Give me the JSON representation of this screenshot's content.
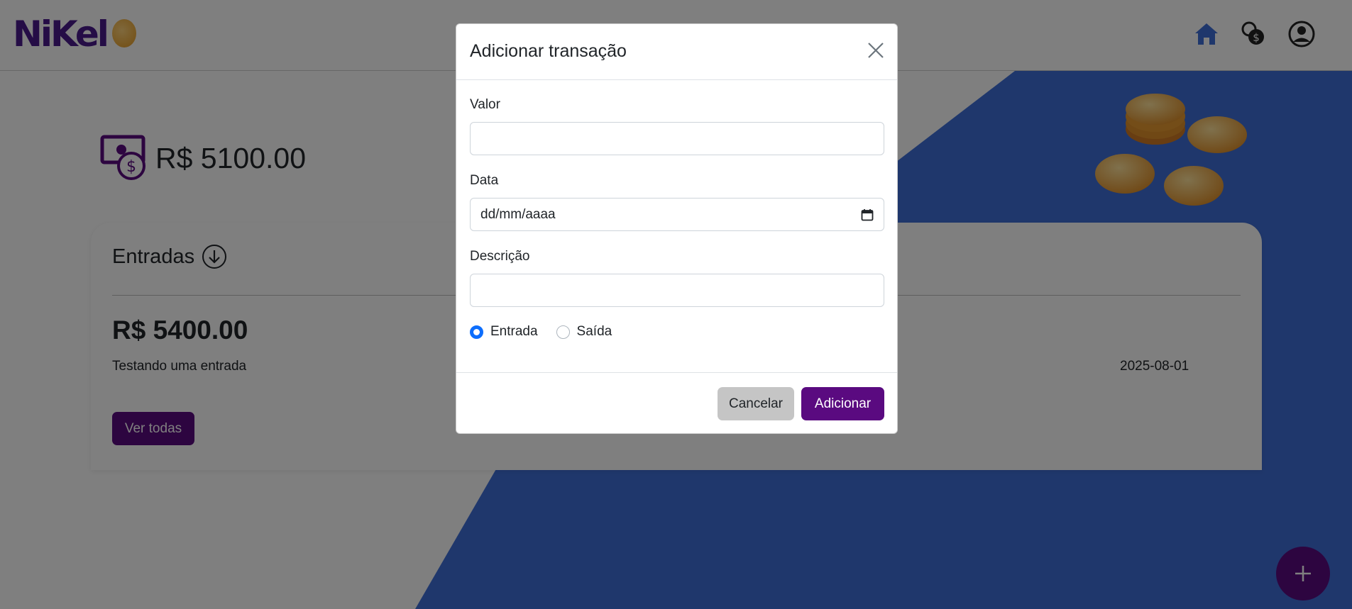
{
  "navbar": {
    "logo_text": "NiKel",
    "icons": [
      "home-icon",
      "currency-exchange-icon",
      "user-circle-icon"
    ]
  },
  "balance": {
    "text": "R$ 5100.00",
    "icon": "money-icon"
  },
  "card": {
    "title": "Entradas",
    "title_icon": "arrow-down-circle-icon",
    "value": "R$ 5400.00",
    "description": "Testando uma entrada",
    "date": "2025-08-01",
    "button_label": "Ver todas"
  },
  "fab": {
    "icon": "plus-icon"
  },
  "modal": {
    "title": "Adicionar transação",
    "fields": {
      "valor_label": "Valor",
      "valor_value": "",
      "data_label": "Data",
      "data_placeholder": "dd/mm/aaaa",
      "descricao_label": "Descrição",
      "descricao_value": ""
    },
    "radios": [
      {
        "label": "Entrada",
        "checked": true
      },
      {
        "label": "Saída",
        "checked": false
      }
    ],
    "cancel_label": "Cancelar",
    "add_label": "Adicionar"
  },
  "colors": {
    "brand_purple": "#5a0a80",
    "background_blue": "#3f6fd8",
    "radio_blue": "#0d6efd",
    "overlay": "rgba(0,0,0,0.5)"
  }
}
